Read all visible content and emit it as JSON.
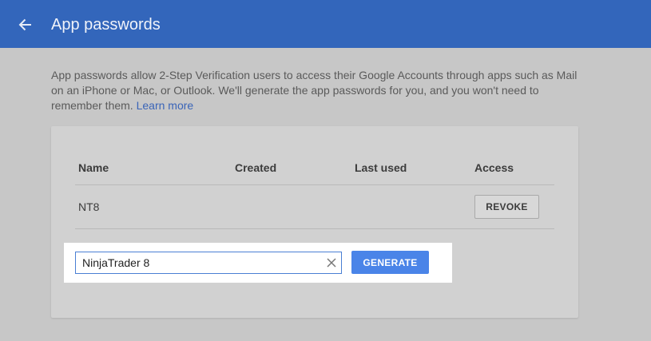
{
  "header": {
    "title": "App passwords",
    "back_icon": "arrow-left-icon",
    "background_color": "#3366bb"
  },
  "intro": {
    "text": "App passwords allow 2-Step Verification users to access their Google Accounts through apps such as Mail on an iPhone or Mac, or Outlook. We'll generate the app passwords for you, and you won't need to remember them. ",
    "link_label": "Learn more",
    "link_color": "#3a64b8"
  },
  "table": {
    "columns": [
      "Name",
      "Created",
      "Last used",
      "Access"
    ],
    "rows": [
      {
        "name": "NT8",
        "created": "",
        "last_used": "",
        "action_label": "REVOKE"
      }
    ]
  },
  "new_password": {
    "input_value": "NinjaTrader 8",
    "clear_icon": "close-icon",
    "generate_label": "GENERATE",
    "accent_color": "#4a84e8"
  }
}
